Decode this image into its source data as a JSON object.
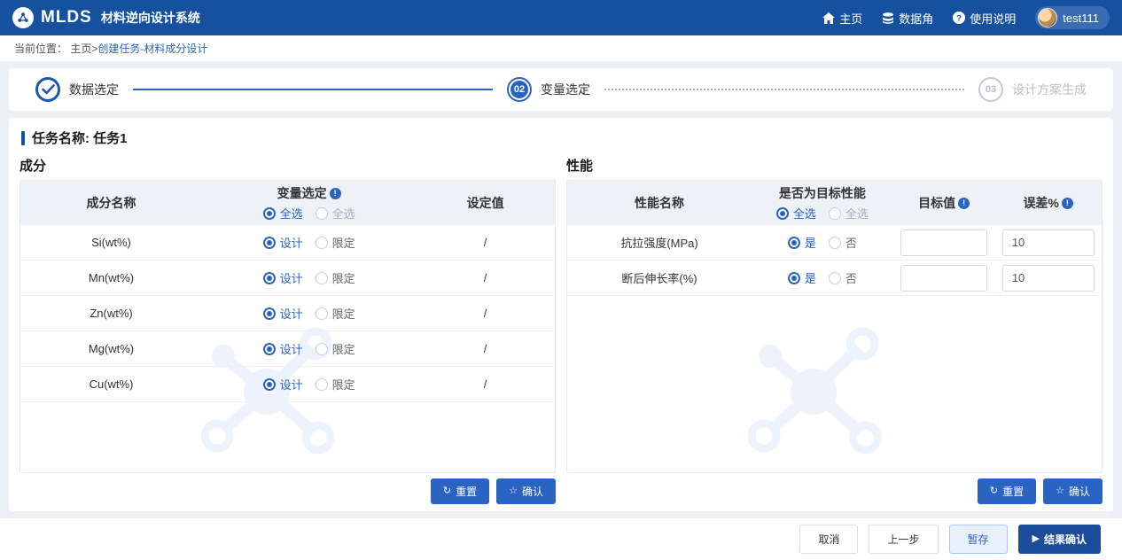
{
  "brand": {
    "logo": "MLDS",
    "title": "材料逆向设计系统"
  },
  "nav": {
    "home": "主页",
    "data": "数据角",
    "help": "使用说明"
  },
  "user": {
    "name": "test111"
  },
  "breadcrumb": {
    "prefix": "当前位置：",
    "home": "主页",
    "sep": ">",
    "current": "创建任务-材料成分设计"
  },
  "stepper": {
    "step1": {
      "label": "数据选定"
    },
    "step2": {
      "num": "02",
      "label": "变量选定"
    },
    "step3": {
      "num": "03",
      "label": "设计方案生成"
    }
  },
  "task": {
    "label": "任务名称:",
    "name": "任务1"
  },
  "composition": {
    "title": "成分",
    "col_name": "成分名称",
    "col_variable": "变量选定",
    "col_value": "设定值",
    "select_all_on": "全选",
    "select_all_off": "全选",
    "opt_design": "设计",
    "opt_limit": "限定",
    "rows": [
      {
        "name": "Si(wt%)",
        "value": "/"
      },
      {
        "name": "Mn(wt%)",
        "value": "/"
      },
      {
        "name": "Zn(wt%)",
        "value": "/"
      },
      {
        "name": "Mg(wt%)",
        "value": "/"
      },
      {
        "name": "Cu(wt%)",
        "value": "/"
      }
    ],
    "reset": "重置",
    "confirm": "确认"
  },
  "performance": {
    "title": "性能",
    "col_name": "性能名称",
    "col_is_target": "是否为目标性能",
    "col_target": "目标值",
    "col_error": "误差%",
    "select_all_on": "全选",
    "select_all_off": "全选",
    "opt_yes": "是",
    "opt_no": "否",
    "rows": [
      {
        "name": "抗拉强度(MPa)",
        "target": "",
        "error": "10"
      },
      {
        "name": "断后伸长率(%)",
        "target": "",
        "error": "10"
      }
    ],
    "reset": "重置",
    "confirm": "确认"
  },
  "footer": {
    "cancel": "取消",
    "prev": "上一步",
    "save": "暂存",
    "confirm": "结果确认"
  },
  "colors": {
    "header": "#15519e",
    "primary": "#2a63c1",
    "dark_primary": "#1b4d9b",
    "watermark": "#edf3fc"
  }
}
